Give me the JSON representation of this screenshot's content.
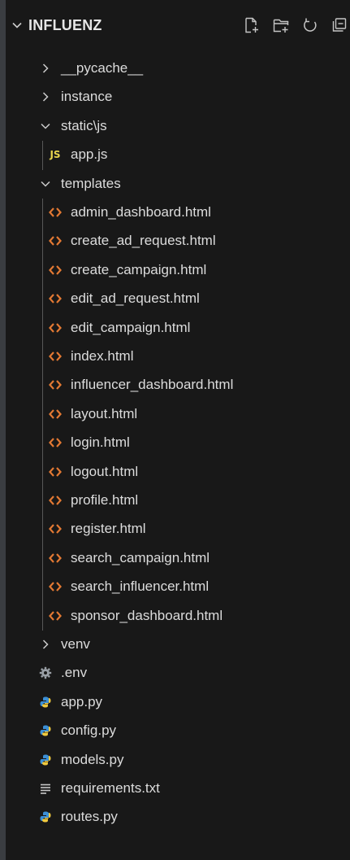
{
  "header": {
    "title": "INFLUENZ"
  },
  "tree": [
    {
      "label": "__pycache__",
      "type": "folder",
      "expanded": false,
      "depth": 1
    },
    {
      "label": "instance",
      "type": "folder",
      "expanded": false,
      "depth": 1
    },
    {
      "label": "static\\js",
      "type": "folder",
      "expanded": true,
      "depth": 1
    },
    {
      "label": "app.js",
      "type": "js",
      "depth": 2
    },
    {
      "label": "templates",
      "type": "folder",
      "expanded": true,
      "depth": 1
    },
    {
      "label": "admin_dashboard.html",
      "type": "html",
      "depth": 2
    },
    {
      "label": "create_ad_request.html",
      "type": "html",
      "depth": 2
    },
    {
      "label": "create_campaign.html",
      "type": "html",
      "depth": 2
    },
    {
      "label": "edit_ad_request.html",
      "type": "html",
      "depth": 2
    },
    {
      "label": "edit_campaign.html",
      "type": "html",
      "depth": 2
    },
    {
      "label": "index.html",
      "type": "html",
      "depth": 2
    },
    {
      "label": "influencer_dashboard.html",
      "type": "html",
      "depth": 2
    },
    {
      "label": "layout.html",
      "type": "html",
      "depth": 2
    },
    {
      "label": "login.html",
      "type": "html",
      "depth": 2
    },
    {
      "label": "logout.html",
      "type": "html",
      "depth": 2
    },
    {
      "label": "profile.html",
      "type": "html",
      "depth": 2
    },
    {
      "label": "register.html",
      "type": "html",
      "depth": 2
    },
    {
      "label": "search_campaign.html",
      "type": "html",
      "depth": 2
    },
    {
      "label": "search_influencer.html",
      "type": "html",
      "depth": 2
    },
    {
      "label": "sponsor_dashboard.html",
      "type": "html",
      "depth": 2
    },
    {
      "label": "venv",
      "type": "folder",
      "expanded": false,
      "depth": 1
    },
    {
      "label": ".env",
      "type": "env",
      "depth": 1
    },
    {
      "label": "app.py",
      "type": "py",
      "depth": 1
    },
    {
      "label": "config.py",
      "type": "py",
      "depth": 1
    },
    {
      "label": "models.py",
      "type": "py",
      "depth": 1
    },
    {
      "label": "requirements.txt",
      "type": "txt",
      "depth": 1
    },
    {
      "label": "routes.py",
      "type": "py",
      "depth": 1
    }
  ],
  "colors": {
    "background": "#181818",
    "text": "#dcdcdc",
    "html_icon": "#e37933",
    "js_icon": "#e8d44d",
    "py_icon": "#3b8fd6",
    "guide": "#585858"
  }
}
